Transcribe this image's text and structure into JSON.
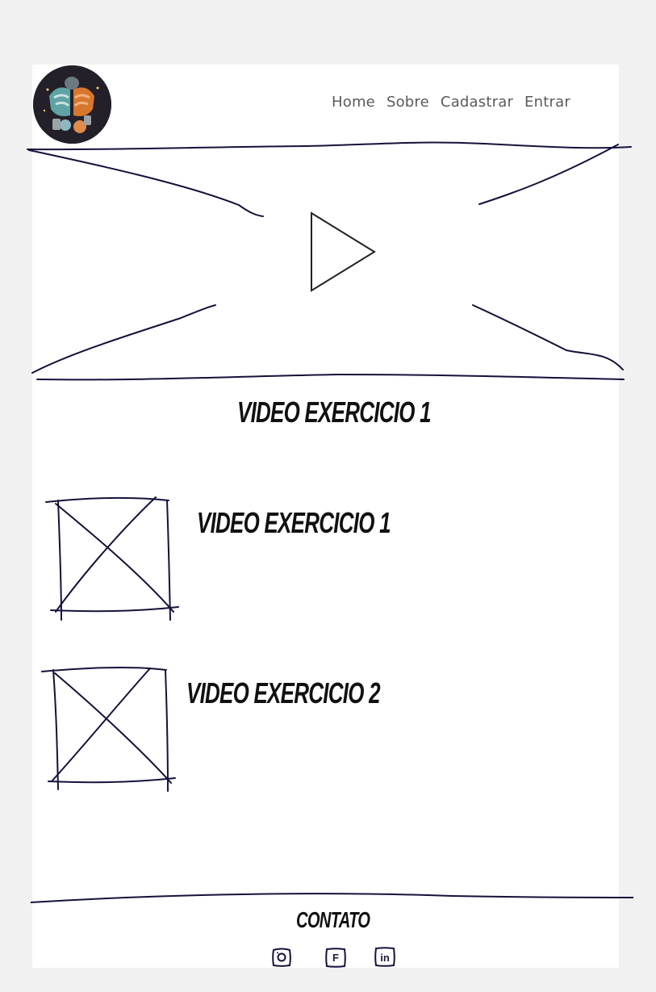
{
  "header": {
    "logo_alt": "bodybuilder logo",
    "nav": [
      "Home",
      "Sobre",
      "Cadastrar",
      "Entrar"
    ]
  },
  "hero": {
    "title": "VIDEO EXERCICIO 1",
    "icon": "play-icon"
  },
  "videos": [
    {
      "title": "VIDEO EXERCICIO 1",
      "icon": "image-placeholder-icon"
    },
    {
      "title": "VIDEO EXERCICIO 2",
      "icon": "image-placeholder-icon"
    }
  ],
  "footer": {
    "title": "CONTATO",
    "social": [
      {
        "name": "instagram-icon",
        "glyph": ""
      },
      {
        "name": "facebook-icon",
        "glyph": "F"
      },
      {
        "name": "linkedin-icon",
        "glyph": "in"
      }
    ]
  },
  "colors": {
    "background": "#f1f1f1",
    "page": "#ffffff",
    "ink": "#14123a",
    "nav_text": "#5a5a5a"
  }
}
